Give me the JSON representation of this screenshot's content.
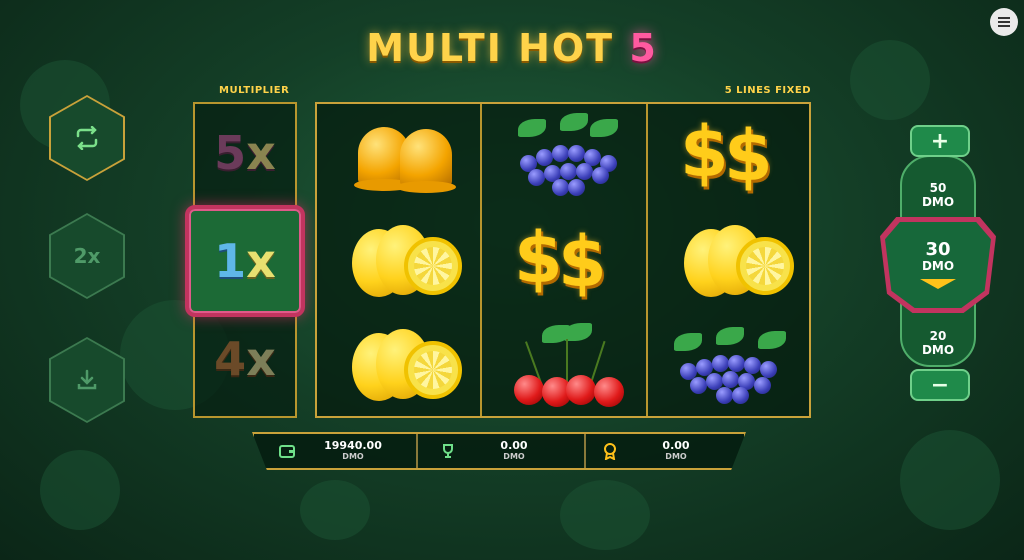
{
  "game": {
    "title_main": "MULTI HOT",
    "title_num": "5"
  },
  "left_controls": [
    {
      "name": "autoplay-button",
      "icon": "repeat-icon",
      "label": ""
    },
    {
      "name": "double-speed-button",
      "icon": "",
      "label": "2x"
    },
    {
      "name": "collect-button",
      "icon": "download-icon",
      "label": ""
    }
  ],
  "multiplier": {
    "label": "MULTIPLIER",
    "top": {
      "num": "5",
      "x": "x"
    },
    "active": {
      "num": "1",
      "x": "x"
    },
    "bottom": {
      "num": "4",
      "x": "x"
    }
  },
  "reels": {
    "lines_label": "5 LINES FIXED",
    "grid": [
      [
        "bells",
        "grapes",
        "dollars"
      ],
      [
        "lemons",
        "dollars",
        "lemons"
      ],
      [
        "lemons",
        "cherries",
        "grapes"
      ]
    ]
  },
  "bet": {
    "plus": "+",
    "minus": "−",
    "upper": {
      "value": "50",
      "currency": "DMO"
    },
    "current": {
      "value": "30",
      "currency": "DMO"
    },
    "lower": {
      "value": "20",
      "currency": "DMO"
    }
  },
  "status": {
    "balance": {
      "value": "19940.00",
      "currency": "DMO",
      "icon": "wallet-icon"
    },
    "win": {
      "value": "0.00",
      "currency": "DMO",
      "icon": "trophy-icon"
    },
    "bonus": {
      "value": "0.00",
      "currency": "DMO",
      "icon": "medal-icon"
    }
  }
}
